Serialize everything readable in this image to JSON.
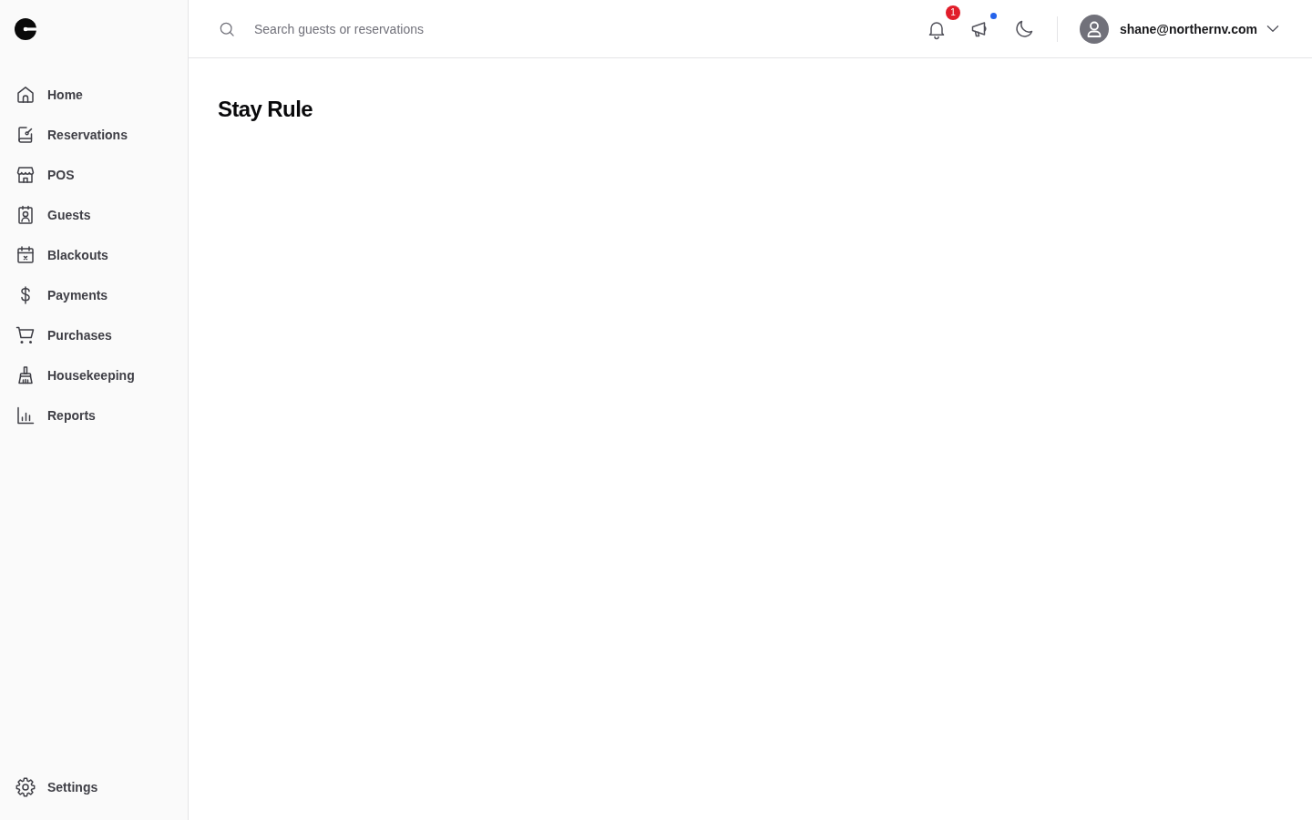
{
  "sidebar": {
    "items": [
      {
        "label": "Home",
        "selected": false
      },
      {
        "label": "Reservations",
        "selected": false
      },
      {
        "label": "POS",
        "selected": false
      },
      {
        "label": "Guests",
        "selected": false
      },
      {
        "label": "Blackouts",
        "selected": false
      },
      {
        "label": "Payments",
        "selected": false
      },
      {
        "label": "Purchases",
        "selected": false
      },
      {
        "label": "Housekeeping",
        "selected": false
      },
      {
        "label": "Reports",
        "selected": false
      }
    ],
    "footer_items": [
      {
        "label": "Settings",
        "selected": false
      }
    ]
  },
  "header": {
    "search": {
      "placeholder": "Search guests or reservations"
    },
    "notifications": {
      "badge": "1"
    },
    "announcements": {
      "unread": true
    },
    "user": {
      "email": "shane@northernv.com"
    }
  },
  "page": {
    "title": "Stay Rule"
  }
}
